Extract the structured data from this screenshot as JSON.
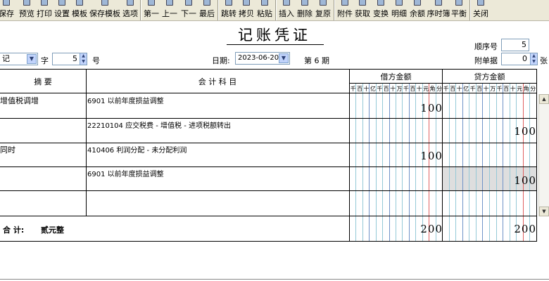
{
  "toolbar": {
    "items": [
      {
        "label": "保存",
        "icon": "save-icon"
      },
      {
        "label": "预览",
        "icon": "preview-icon"
      },
      {
        "label": "打印",
        "icon": "print-icon"
      },
      {
        "label": "设置",
        "icon": "settings-icon"
      },
      {
        "label": "模板",
        "icon": "template-icon"
      },
      {
        "label": "保存模板",
        "icon": "save-template-icon"
      },
      {
        "label": "选项",
        "icon": "options-icon"
      },
      {
        "label": "第一",
        "icon": "first-icon"
      },
      {
        "label": "上一",
        "icon": "previous-icon"
      },
      {
        "label": "下一",
        "icon": "next-icon"
      },
      {
        "label": "最后",
        "icon": "last-icon"
      },
      {
        "label": "跳转",
        "icon": "jump-icon"
      },
      {
        "label": "拷贝",
        "icon": "copy-icon"
      },
      {
        "label": "粘贴",
        "icon": "paste-icon"
      },
      {
        "label": "插入",
        "icon": "insert-icon"
      },
      {
        "label": "删除",
        "icon": "delete-icon"
      },
      {
        "label": "复原",
        "icon": "restore-icon"
      },
      {
        "label": "附件",
        "icon": "attachment-icon"
      },
      {
        "label": "获取",
        "icon": "fetch-icon"
      },
      {
        "label": "变换",
        "icon": "transform-icon"
      },
      {
        "label": "明细",
        "icon": "detail-icon"
      },
      {
        "label": "余额",
        "icon": "balance-icon"
      },
      {
        "label": "序时簿",
        "icon": "journal-icon"
      },
      {
        "label": "平衡",
        "icon": "balance-check-icon"
      },
      {
        "label": "关闭",
        "icon": "close-icon"
      }
    ]
  },
  "voucher": {
    "title": "记账凭证",
    "seq_label": "顺序号",
    "seq_value": "5",
    "word_select": "记",
    "word_label": "字",
    "number_value": "5",
    "number_label": "号",
    "date_label": "日期:",
    "date_value": "2023-06-20",
    "period_text": "第 6 期",
    "attach_label": "附单据",
    "attach_value": "0",
    "attach_unit": "张"
  },
  "grid": {
    "summary_header": "摘  要",
    "account_header": "会  计  科  目",
    "debit_header": "借方金额",
    "credit_header": "贷方金额",
    "digit_units": [
      "千",
      "百",
      "十",
      "亿",
      "千",
      "百",
      "十",
      "万",
      "千",
      "百",
      "十",
      "元",
      "角",
      "分"
    ],
    "rows": [
      {
        "summary": "增值税调增",
        "account": "6901 以前年度损益调整",
        "debit": "100",
        "credit": ""
      },
      {
        "summary": "",
        "account": "22210104 应交税费 - 增值税 - 进项税额转出",
        "debit": "",
        "credit": "100"
      },
      {
        "summary": "同时",
        "account": "410406 利润分配 - 未分配利润",
        "debit": "100",
        "credit": ""
      },
      {
        "summary": "",
        "account": "6901 以前年度损益调整",
        "debit": "",
        "credit": "100"
      },
      {
        "summary": "",
        "account": "",
        "debit": "",
        "credit": ""
      }
    ],
    "total_label": "合  计:",
    "total_words": "贰元整",
    "total_debit": "200",
    "total_credit": "200"
  }
}
